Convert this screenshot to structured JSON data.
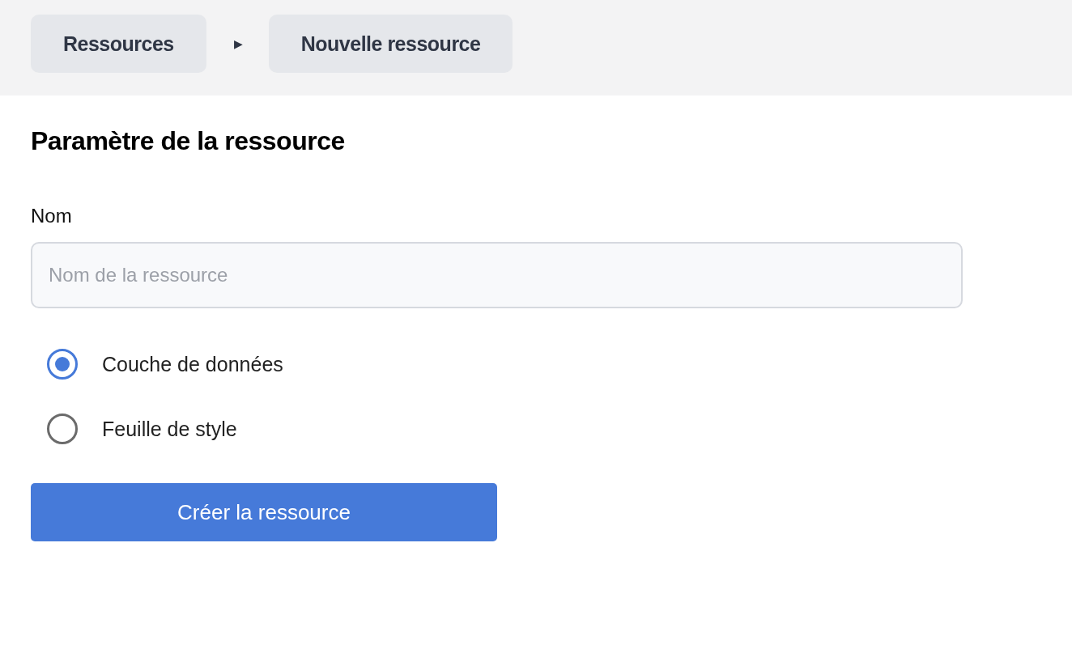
{
  "breadcrumb": {
    "items": [
      {
        "label": "Ressources"
      },
      {
        "label": "Nouvelle ressource"
      }
    ],
    "separator": "▶"
  },
  "section": {
    "title": "Paramètre de la ressource"
  },
  "name_field": {
    "label": "Nom",
    "placeholder": "Nom de la ressource"
  },
  "resource_types": [
    {
      "label": "Couche de données",
      "selected": true
    },
    {
      "label": "Feuille de style",
      "selected": false
    }
  ],
  "submit_button": "Créer la ressource"
}
